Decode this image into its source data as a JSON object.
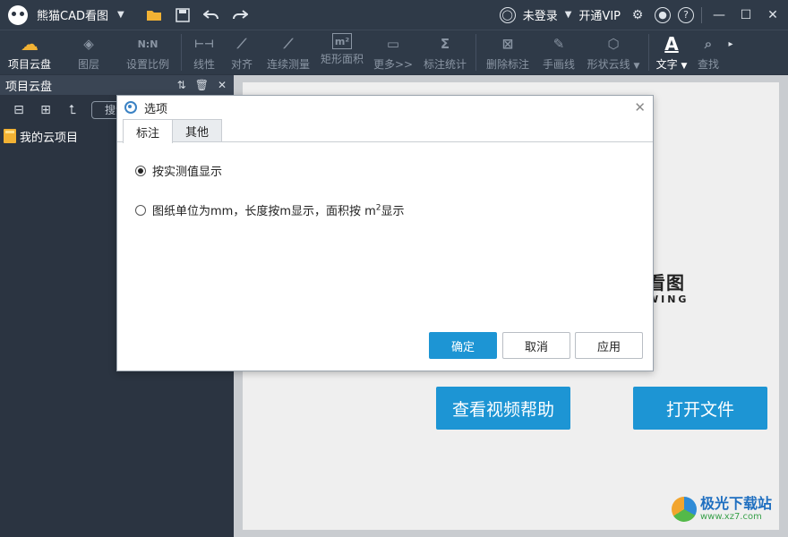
{
  "titlebar": {
    "app_title": "熊猫CAD看图",
    "login": "未登录",
    "vip": "开通VIP",
    "icons": [
      "folder-icon",
      "save-icon",
      "undo-icon",
      "redo-icon",
      "user-icon",
      "settings-icon",
      "bell-icon",
      "help-icon",
      "minimize-icon",
      "maximize-icon",
      "close-icon"
    ]
  },
  "toolbar": {
    "items": [
      {
        "label": "项目云盘",
        "icon": "cloud-icon",
        "glyph": "☁",
        "active": true
      },
      {
        "label": "图层",
        "icon": "layers-icon",
        "glyph": "◈",
        "active": false
      },
      {
        "label": "设置比例",
        "icon": "scale-icon",
        "glyph": "N:N",
        "active": false
      },
      {
        "label": "线性",
        "icon": "linear-measure-icon",
        "glyph": "⊢⊣",
        "active": false
      },
      {
        "label": "对齐",
        "icon": "align-measure-icon",
        "glyph": "⟋",
        "active": false
      },
      {
        "label": "连续测量",
        "icon": "continuous-measure-icon",
        "glyph": "⟋",
        "active": false
      },
      {
        "label": "矩形面积",
        "icon": "rect-area-icon",
        "glyph": "m²",
        "active": false
      },
      {
        "label": "更多>>",
        "icon": "more-icon",
        "glyph": "▭",
        "active": false
      },
      {
        "label": "标注统计",
        "icon": "stats-icon",
        "glyph": "Σ",
        "active": false
      },
      {
        "label": "删除标注",
        "icon": "delete-annotation-icon",
        "glyph": "⊠",
        "active": false
      },
      {
        "label": "手画线",
        "icon": "freehand-icon",
        "glyph": "✎",
        "active": false
      },
      {
        "label": "形状云线",
        "icon": "shape-cloud-icon",
        "glyph": "⬡",
        "active": false,
        "dropdown": true
      },
      {
        "label": "文字",
        "icon": "text-icon",
        "glyph": "A",
        "active": true,
        "dropdown": true
      },
      {
        "label": "查找",
        "icon": "find-icon",
        "glyph": "⌕",
        "active": false
      }
    ]
  },
  "sidebar": {
    "title": "项目云盘",
    "search_placeholder": "搜索",
    "tree_item": "我的云项目"
  },
  "main": {
    "logo_text": "看图",
    "logo_sub": "WING",
    "help_button": "查看视频帮助",
    "open_button": "打开文件",
    "watermark_title": "极光下载站",
    "watermark_url": "www.xz7.com"
  },
  "dialog": {
    "title": "选项",
    "tabs": [
      "标注",
      "其他"
    ],
    "option1": "按实测值显示",
    "option2_prefix": "图纸单位为mm，长度按m显示，面积按 m",
    "option2_sup": "2",
    "option2_suffix": "显示",
    "ok": "确定",
    "cancel": "取消",
    "apply": "应用"
  },
  "colors": {
    "accent": "#1d95d4",
    "chrome": "#2f3a48",
    "sidebar": "#2b3441"
  }
}
